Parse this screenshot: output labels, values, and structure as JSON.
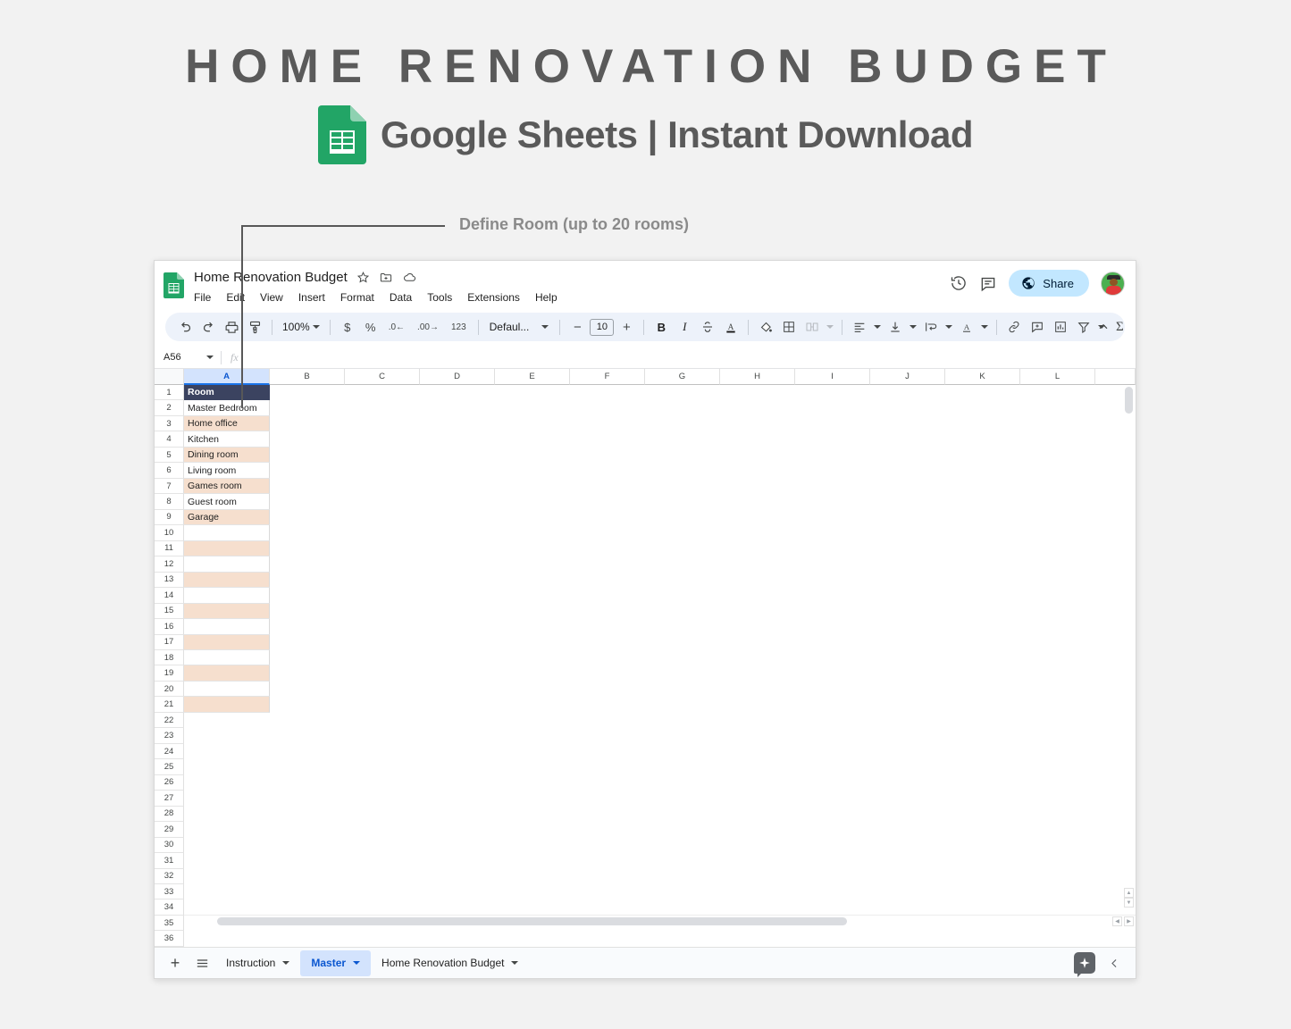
{
  "promo": {
    "title": "HOME RENOVATION BUDGET",
    "subtitle": "Google Sheets | Instant Download",
    "logo_icon": "google-sheets-logo-icon"
  },
  "callout": {
    "label": "Define Room (up to 20 rooms)"
  },
  "app": {
    "doc_title": "Home Renovation Budget",
    "logo_icon": "google-sheets-logo-icon",
    "title_icons": [
      {
        "name": "star-icon",
        "glyph": "☆"
      },
      {
        "name": "move-to-folder-icon",
        "glyph": "⧉"
      },
      {
        "name": "cloud-saved-icon",
        "glyph": "☁"
      }
    ],
    "menu": [
      "File",
      "Edit",
      "View",
      "Insert",
      "Format",
      "Data",
      "Tools",
      "Extensions",
      "Help"
    ],
    "header_actions": {
      "history_icon": "version-history-icon",
      "comment_icon": "comment-history-icon",
      "share_label": "Share",
      "share_icon": "globe-icon",
      "share_bg": "#c2e7ff",
      "avatar_name": "user-avatar"
    }
  },
  "toolbar": {
    "zoom_value": "100%",
    "font_value": "Defaul...",
    "font_size": "10",
    "items": [
      {
        "name": "undo-icon",
        "glyph": "↶"
      },
      {
        "name": "redo-icon",
        "glyph": "↷"
      },
      {
        "name": "print-icon",
        "glyph": "⎙"
      },
      {
        "name": "paint-format-icon",
        "glyph": "὘C"
      },
      {
        "name": "currency-format-icon",
        "glyph": "$"
      },
      {
        "name": "percent-format-icon",
        "glyph": "%"
      },
      {
        "name": "decrease-decimal-icon",
        "glyph": ".0"
      },
      {
        "name": "increase-decimal-icon",
        "glyph": ".00"
      },
      {
        "name": "more-formats-icon",
        "glyph": "123"
      },
      {
        "name": "decrease-font-size-icon",
        "glyph": "−"
      },
      {
        "name": "increase-font-size-icon",
        "glyph": "+"
      },
      {
        "name": "bold-icon",
        "glyph": "B"
      },
      {
        "name": "italic-icon",
        "glyph": "I"
      },
      {
        "name": "strikethrough-icon",
        "glyph": "S"
      },
      {
        "name": "text-color-icon",
        "glyph": "A"
      },
      {
        "name": "fill-color-icon",
        "glyph": "▲"
      },
      {
        "name": "borders-icon",
        "glyph": "⊞"
      },
      {
        "name": "merge-cells-icon",
        "glyph": "⬚"
      },
      {
        "name": "horizontal-align-icon",
        "glyph": "☰"
      },
      {
        "name": "vertical-align-icon",
        "glyph": "⤓"
      },
      {
        "name": "text-wrapping-icon",
        "glyph": "↵"
      },
      {
        "name": "text-rotation-icon",
        "glyph": "A"
      },
      {
        "name": "insert-link-icon",
        "glyph": "ὑ7"
      },
      {
        "name": "insert-comment-icon",
        "glyph": "⬜"
      },
      {
        "name": "insert-chart-icon",
        "glyph": "ὌA"
      },
      {
        "name": "create-filter-icon",
        "glyph": "▽"
      },
      {
        "name": "functions-icon",
        "glyph": "Σ"
      },
      {
        "name": "collapse-toolbar-icon",
        "glyph": "⌃"
      }
    ]
  },
  "formula_bar": {
    "name_box": "A56",
    "fx_label": "fx",
    "formula_value": ""
  },
  "grid": {
    "columns": [
      "A",
      "B",
      "C",
      "D",
      "E",
      "F",
      "G",
      "H",
      "I",
      "J",
      "K",
      "L"
    ],
    "selected_column": "A",
    "visible_rows": 36,
    "header_bg": "#3b4360",
    "band_bg": "#f6dfce",
    "rows": [
      {
        "n": 1,
        "a": "Room",
        "style": "header"
      },
      {
        "n": 2,
        "a": "Master Bedroom",
        "style": "plain"
      },
      {
        "n": 3,
        "a": "Home office",
        "style": "band"
      },
      {
        "n": 4,
        "a": "Kitchen",
        "style": "plain"
      },
      {
        "n": 5,
        "a": "Dining room",
        "style": "band"
      },
      {
        "n": 6,
        "a": "Living room",
        "style": "plain"
      },
      {
        "n": 7,
        "a": "Games room",
        "style": "band"
      },
      {
        "n": 8,
        "a": "Guest room",
        "style": "plain"
      },
      {
        "n": 9,
        "a": "Garage",
        "style": "band"
      },
      {
        "n": 10,
        "a": "",
        "style": "plain"
      },
      {
        "n": 11,
        "a": "",
        "style": "band"
      },
      {
        "n": 12,
        "a": "",
        "style": "plain"
      },
      {
        "n": 13,
        "a": "",
        "style": "band"
      },
      {
        "n": 14,
        "a": "",
        "style": "plain"
      },
      {
        "n": 15,
        "a": "",
        "style": "band"
      },
      {
        "n": 16,
        "a": "",
        "style": "plain"
      },
      {
        "n": 17,
        "a": "",
        "style": "band"
      },
      {
        "n": 18,
        "a": "",
        "style": "plain"
      },
      {
        "n": 19,
        "a": "",
        "style": "band"
      },
      {
        "n": 20,
        "a": "",
        "style": "plain"
      },
      {
        "n": 21,
        "a": "",
        "style": "band"
      },
      {
        "n": 22,
        "a": "",
        "style": "empty"
      },
      {
        "n": 23,
        "a": "",
        "style": "empty"
      },
      {
        "n": 24,
        "a": "",
        "style": "empty"
      },
      {
        "n": 25,
        "a": "",
        "style": "empty"
      },
      {
        "n": 26,
        "a": "",
        "style": "empty"
      },
      {
        "n": 27,
        "a": "",
        "style": "empty"
      },
      {
        "n": 28,
        "a": "",
        "style": "empty"
      },
      {
        "n": 29,
        "a": "",
        "style": "empty"
      },
      {
        "n": 30,
        "a": "",
        "style": "empty"
      },
      {
        "n": 31,
        "a": "",
        "style": "empty"
      },
      {
        "n": 32,
        "a": "",
        "style": "empty"
      },
      {
        "n": 33,
        "a": "",
        "style": "empty"
      },
      {
        "n": 34,
        "a": "",
        "style": "empty"
      },
      {
        "n": 35,
        "a": "",
        "style": "empty"
      },
      {
        "n": 36,
        "a": "",
        "style": "empty"
      }
    ]
  },
  "sheet_tabs": {
    "add_label": "+",
    "all_sheets_icon": "all-sheets-menu-icon",
    "tabs": [
      {
        "label": "Instruction",
        "active": false
      },
      {
        "label": "Master",
        "active": true
      },
      {
        "label": "Home Renovation Budget",
        "active": false
      }
    ],
    "explore_icon": "explore-gemini-icon",
    "collapse_icon": "collapse-panel-icon"
  }
}
